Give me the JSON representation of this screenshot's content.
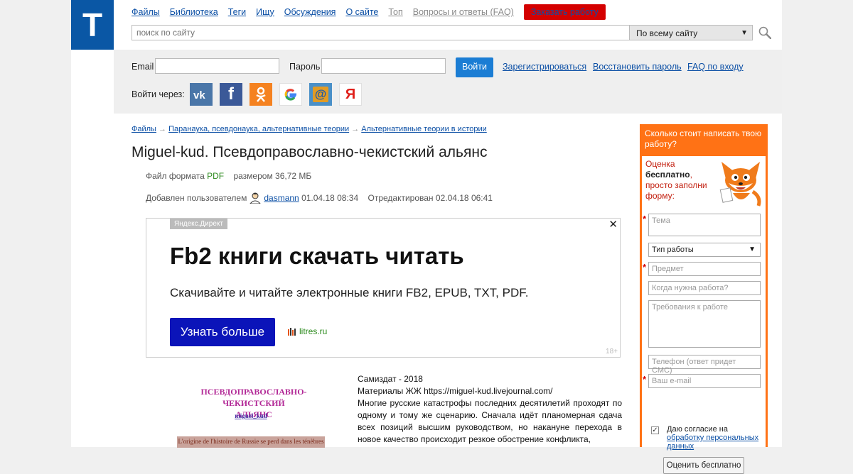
{
  "header": {
    "logo_letter": "T",
    "nav": [
      {
        "label": "Файлы"
      },
      {
        "label": "Библиотека"
      },
      {
        "label": "Теги"
      },
      {
        "label": "Ищу"
      },
      {
        "label": "Обсуждения"
      },
      {
        "label": "О сайте"
      },
      {
        "label": "Топ"
      },
      {
        "label": "Вопросы и ответы (FAQ)"
      }
    ],
    "order_button": "Заказать работу",
    "search_placeholder": "поиск по сайту",
    "search_scope": "По всему сайту"
  },
  "login": {
    "email_label": "Email",
    "password_label": "Пароль",
    "submit": "Войти",
    "register": "Зарегистрироваться",
    "restore": "Восстановить пароль",
    "faq": "FAQ по входу",
    "via_label": "Войти через:",
    "social": [
      {
        "name": "vk",
        "glyph": "vk",
        "color": "#4a76a8"
      },
      {
        "name": "facebook",
        "glyph": "f",
        "color": "#3b5998"
      },
      {
        "name": "odnoklassniki",
        "glyph": "ok",
        "color": "#f58220"
      },
      {
        "name": "google",
        "glyph": "G",
        "color": "#ffffff"
      },
      {
        "name": "mail",
        "glyph": "@",
        "color": "#4a90c8"
      },
      {
        "name": "yandex",
        "glyph": "Я",
        "color": "#ffffff"
      }
    ]
  },
  "breadcrumbs": {
    "items": [
      "Файлы",
      "Паранаука, псевдонаука, альтернативные теории",
      "Альтернативные теории в истории"
    ],
    "separator": "→"
  },
  "file": {
    "title": "Miguel-kud. Псевдоправославно-чекистский альянс",
    "format_prefix": "Файл формата",
    "format": "PDF",
    "size": "размером 36,72 МБ",
    "added_prefix": "Добавлен пользователем",
    "user": "dasmann",
    "added_date": "01.04.18 08:34",
    "edited": "Отредактирован 02.04.18 06:41"
  },
  "ad": {
    "tag": "Яндекс.Директ",
    "close": "✕",
    "headline": "Fb2 книги скачать читать",
    "subline": "Скачивайте и читайте электронные книги FB2, EPUB, TXT, PDF.",
    "button": "Узнать больше",
    "site": "litres.ru",
    "age": "18+"
  },
  "cover": {
    "title_line1": "ПСЕВДОПРАВОСЛАВНО-ЧЕКИСТСКИЙ",
    "title_line2": "АЛЬЯНС",
    "author": "miguel_kud",
    "image_caption": "L'origine de l'histoire de Russie se perd dans les ténèbres"
  },
  "description": {
    "line1": "Самиздат - 2018",
    "line2": "Материалы ЖЖ https://miguel-kud.livejournal.com/",
    "body": "Многие русские катастрофы последних десятилетий проходят по одному и тому же сценарию. Сначала идёт планомерная сдача всех позиций высшим руководством, но накануне перехода в новое качество происходит резкое обострение конфликта,"
  },
  "sidebar": {
    "heading": "Сколько стоит написать твою работу?",
    "intro_prefix": "Оценка ",
    "intro_bold": "бесплатно",
    "intro_suffix": ", просто заполни форму:",
    "fields": {
      "topic": "Тема",
      "work_type": "Тип работы",
      "subject": "Предмет",
      "deadline": "Когда нужна работа?",
      "requirements": "Требования к работе",
      "phone": "Телефон (ответ придет СМС)",
      "email": "Ваш e-mail"
    },
    "consent_prefix": "Даю согласие на ",
    "consent_link": "обработку персональных данных",
    "submit": "Оценить бесплатно",
    "required_mark": "*"
  }
}
